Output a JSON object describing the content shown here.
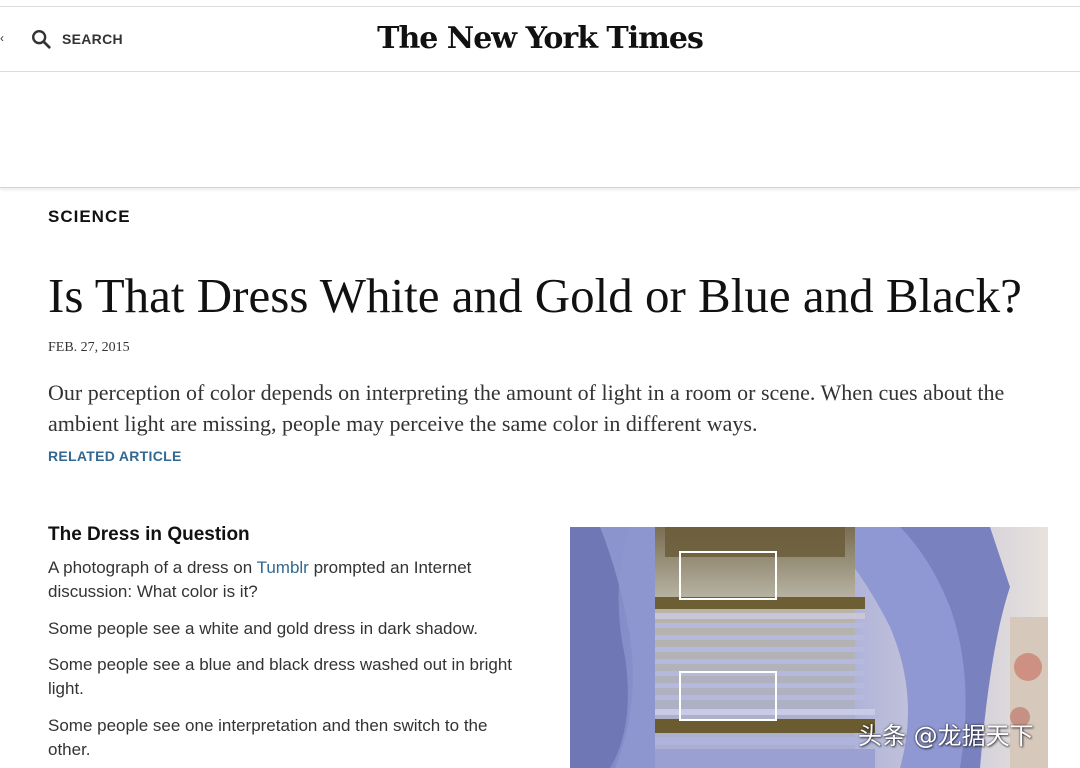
{
  "header": {
    "search_label": "SEARCH",
    "masthead": "The New York Times"
  },
  "article": {
    "kicker": "SCIENCE",
    "headline": "Is That Dress White and Gold or Blue and Black?",
    "date": "FEB. 27, 2015",
    "summary": "Our perception of color depends on interpreting the amount of light in a room or scene. When cues about the ambient light are missing, people may perceive the same color in different ways.",
    "related_link": "RELATED ARTICLE"
  },
  "section": {
    "title": "The Dress in Question",
    "p1_before": "A photograph of a dress on ",
    "p1_link": "Tumblr",
    "p1_after": " prompted an Internet discussion: What color is it?",
    "p2": "Some people see a white and gold dress in dark shadow.",
    "p3": "Some people see a blue and black dress washed out in bright light.",
    "p4": "Some people see one interpretation and then switch to the other."
  },
  "watermark": "头条 @龙据天下",
  "colors": {
    "link": "#326891",
    "text": "#333333",
    "dress_blue": "#8f9ad4",
    "dress_gold": "#7a6a3a"
  },
  "icons": {
    "search": "search-icon"
  }
}
